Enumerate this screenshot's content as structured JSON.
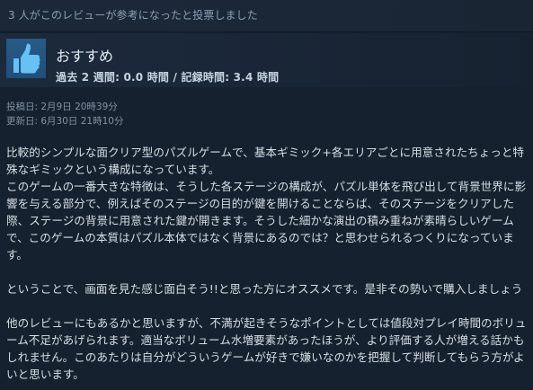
{
  "helpful": {
    "text": "3 人がこのレビューが参考になったと投票しました"
  },
  "recommendation": {
    "title": "おすすめ",
    "hours": "過去 2 週間: 0.0 時間 / 記録時間: 3.4 時間",
    "icon": "thumbs-up-icon"
  },
  "dates": {
    "posted": "投稿日: 2月9日 20時39分",
    "updated": "更新日: 6月30日 21時10分"
  },
  "review": {
    "paragraph1": "比較的シンプルな面クリア型のパズルゲームで、基本ギミック+各エリアごとに用意されたちょっと特殊なギミックという構成になっています。",
    "paragraph2": "このゲームの一番大きな特徴は、そうした各ステージの構成が、パズル単体を飛び出して背景世界に影響を与える部分で、例えばそのステージの目的が鍵を開けることならば、そのステージをクリアした際、ステージの背景に用意された鍵が開きます。そうした細かな演出の積み重ねが素晴らしいゲームで、このゲームの本質はパズル本体ではなく背景にあるのでは？と思わせられるつくりになっています。",
    "paragraph3": "ということで、画面を見た感じ面白そう!!と思った方にオススメです。是非その勢いで購入しましょう",
    "paragraph4": "他のレビューにもあるかと思いますが、不満が起きそうなポイントとしては値段対プレイ時間のボリューム不足があげられます。適当なボリューム水増要素があったほうが、より評価する人が増える話かもしれません。このあたりは自分がどういうゲームが好きで嫌いなのかを把握して判断してもらう方がよいと思います。"
  },
  "colors": {
    "background": "#15212e",
    "panel": "#1a2738",
    "thumb_bg": "#2a5a86",
    "thumb_fg": "#67c1f5"
  }
}
